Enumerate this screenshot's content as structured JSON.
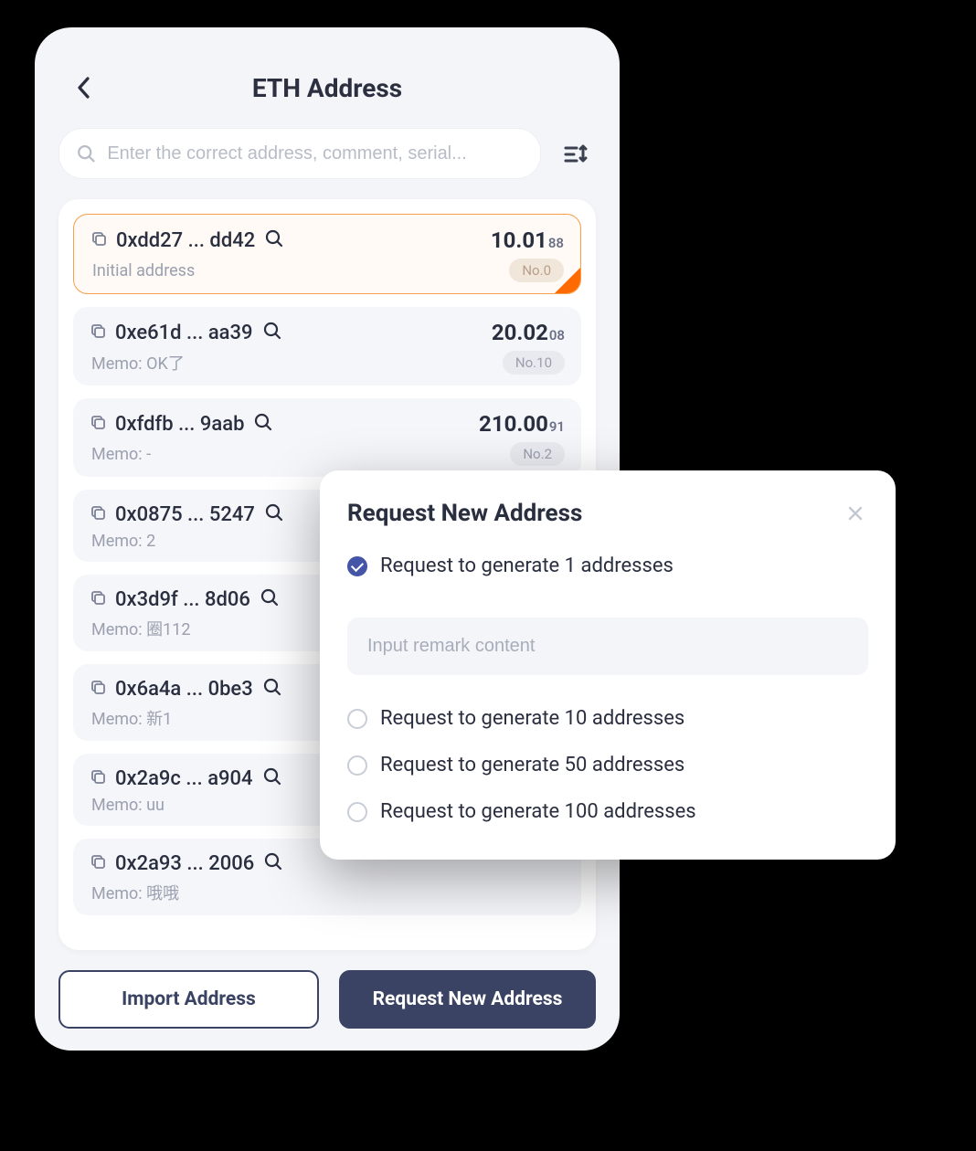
{
  "header": {
    "title": "ETH Address"
  },
  "search": {
    "placeholder": "Enter the correct address, comment, serial..."
  },
  "addresses": [
    {
      "addr": "0xdd27 ... dd42",
      "balance_main": "10.01",
      "balance_frac": "88",
      "memo": "Initial address",
      "seq": "No.0",
      "selected": true
    },
    {
      "addr": "0xe61d ... aa39",
      "balance_main": "20.02",
      "balance_frac": "08",
      "memo": "Memo: OK了",
      "seq": "No.10",
      "selected": false
    },
    {
      "addr": "0xfdfb ... 9aab",
      "balance_main": "210.00",
      "balance_frac": "91",
      "memo": "Memo: -",
      "seq": "No.2",
      "selected": false
    },
    {
      "addr": "0x0875 ... 5247",
      "balance_main": "",
      "balance_frac": "",
      "memo": "Memo: 2",
      "seq": "",
      "selected": false
    },
    {
      "addr": "0x3d9f ... 8d06",
      "balance_main": "",
      "balance_frac": "",
      "memo": "Memo: 圈112",
      "seq": "",
      "selected": false
    },
    {
      "addr": "0x6a4a ... 0be3",
      "balance_main": "",
      "balance_frac": "",
      "memo": "Memo: 新1",
      "seq": "",
      "selected": false
    },
    {
      "addr": "0x2a9c ... a904",
      "balance_main": "",
      "balance_frac": "",
      "memo": "Memo: uu",
      "seq": "",
      "selected": false
    },
    {
      "addr": "0x2a93 ... 2006",
      "balance_main": "",
      "balance_frac": "",
      "memo": "Memo: 哦哦",
      "seq": "",
      "selected": false
    }
  ],
  "footer": {
    "import_label": "Import Address",
    "request_label": "Request New Address"
  },
  "modal": {
    "title": "Request New Address",
    "remark_placeholder": "Input remark content",
    "options": [
      {
        "label": "Request to generate 1 addresses",
        "checked": true
      },
      {
        "label": "Request to generate 10 addresses",
        "checked": false
      },
      {
        "label": "Request to generate 50 addresses",
        "checked": false
      },
      {
        "label": "Request to generate 100 addresses",
        "checked": false
      }
    ]
  }
}
